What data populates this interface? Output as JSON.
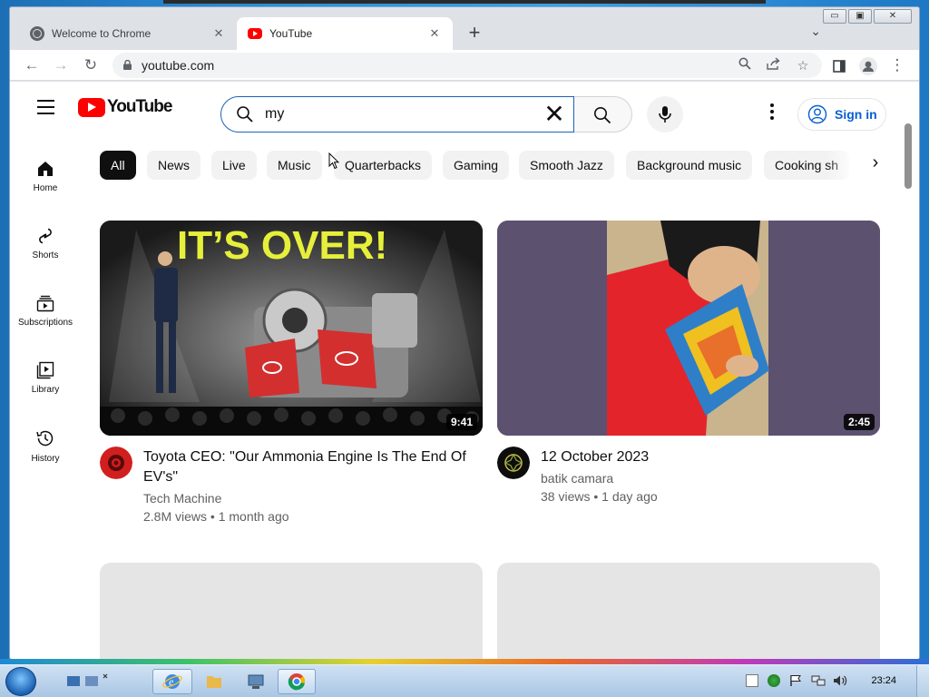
{
  "browser": {
    "tabs": [
      {
        "title": "Welcome to Chrome",
        "icon": "globe-icon"
      },
      {
        "title": "YouTube",
        "icon": "youtube-favicon",
        "active": true
      }
    ],
    "new_tab_label": "+",
    "url": "youtube.com"
  },
  "youtube": {
    "logo_text": "YouTube",
    "search_query": "my",
    "sign_in_label": "Sign in",
    "rail": [
      {
        "label": "Home",
        "icon": "home-icon"
      },
      {
        "label": "Shorts",
        "icon": "shorts-icon"
      },
      {
        "label": "Subscriptions",
        "icon": "subscriptions-icon"
      },
      {
        "label": "Library",
        "icon": "library-icon"
      },
      {
        "label": "History",
        "icon": "history-icon"
      }
    ],
    "chips": [
      "All",
      "News",
      "Live",
      "Music",
      "Quarterbacks",
      "Gaming",
      "Smooth Jazz",
      "Background music",
      "Cooking sh"
    ],
    "videos": [
      {
        "thumb_text": "IT’S OVER!",
        "duration": "9:41",
        "title_line1": "Toyota CEO: \"Our Ammonia Engine Is The End Of",
        "title_line2": "EV's\"",
        "channel": "Tech Machine",
        "meta": "2.8M views • 1 month ago"
      },
      {
        "duration": "2:45",
        "title_line1": "12 October 2023",
        "channel": "batik camara",
        "meta": "38 views • 1 day ago"
      }
    ]
  },
  "taskbar": {
    "clock": "23:24"
  },
  "colors": {
    "yt_red": "#ff0000",
    "link_blue": "#065fd4",
    "chip_bg": "#f2f2f2"
  }
}
